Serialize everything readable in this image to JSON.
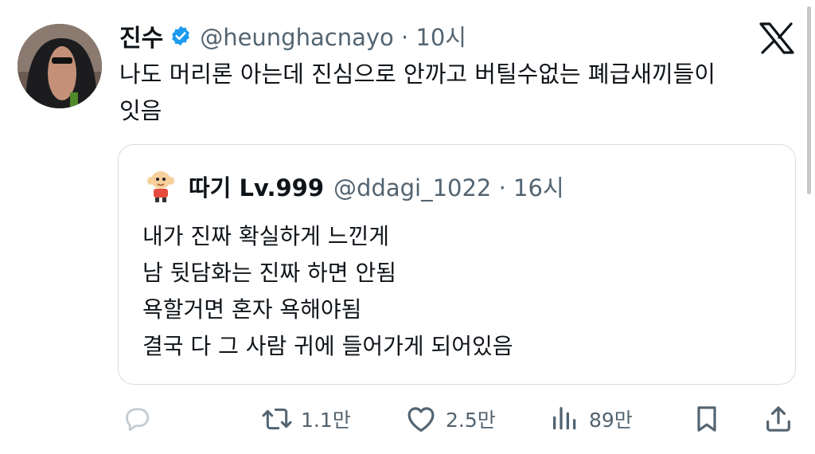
{
  "tweet": {
    "display_name": "진수",
    "handle_time": "@heunghacnayo · 10시",
    "text_lines": [
      "나도 머리론 아는데 진심으로 안까고 버틸수없는 폐급새끼들이",
      "잇음"
    ]
  },
  "quoted_tweet": {
    "display_name": "따기 Lv.999",
    "handle_time": "@ddagi_1022 · 16시",
    "lines": [
      "내가 진짜 확실하게 느낀게",
      "남 뒷담화는 진짜 하면 안됨",
      "욕할거면 혼자 욕해야됨",
      "결국 다 그 사람 귀에 들어가게 되어있음"
    ]
  },
  "actions": {
    "retweets": "1.1만",
    "likes": "2.5만",
    "views": "89만"
  },
  "icons": [
    "x-logo-icon",
    "verified-badge-icon",
    "reply-icon",
    "retweet-icon",
    "like-icon",
    "views-icon",
    "bookmark-icon",
    "share-icon"
  ],
  "colors": {
    "verified": "#1d9bf0",
    "secondary_text": "#536471"
  }
}
